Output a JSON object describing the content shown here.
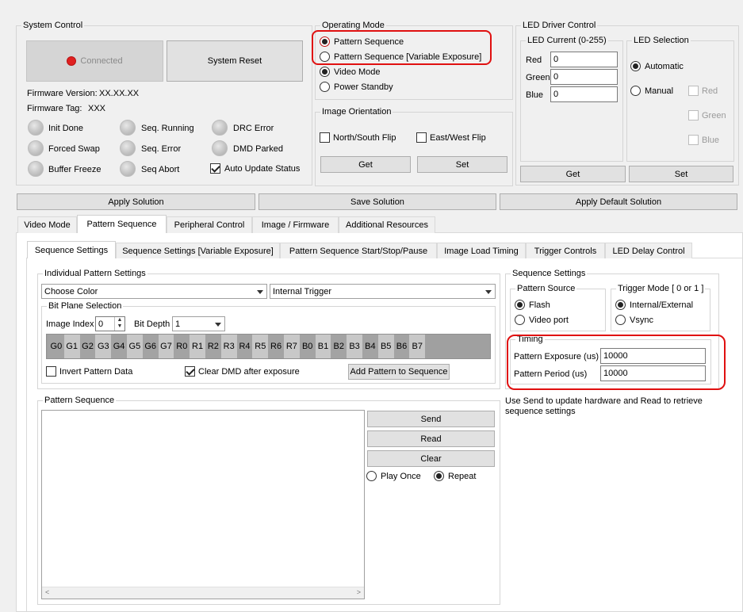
{
  "system_control": {
    "title": "System Control",
    "connected_label": "Connected",
    "reset_label": "System Reset",
    "firmware_version_label": "Firmware Version:",
    "firmware_version": "XX.XX.XX",
    "firmware_tag_label": "Firmware Tag:",
    "firmware_tag": "XXX",
    "status": {
      "init_done": "Init Done",
      "seq_running": "Seq. Running",
      "drc_error": "DRC Error",
      "forced_swap": "Forced Swap",
      "seq_error": "Seq. Error",
      "dmd_parked": "DMD Parked",
      "buffer_freeze": "Buffer Freeze",
      "seq_abort": "Seq Abort",
      "auto_update": "Auto Update Status"
    }
  },
  "operating_mode": {
    "title": "Operating Mode",
    "options": [
      "Pattern Sequence",
      "Pattern Sequence [Variable Exposure]",
      "Video Mode",
      "Power Standby"
    ]
  },
  "image_orientation": {
    "title": "Image Orientation",
    "ns_flip": "North/South Flip",
    "ew_flip": "East/West Flip",
    "get_label": "Get",
    "set_label": "Set"
  },
  "led_driver": {
    "title": "LED Driver Control",
    "current_title": "LED Current (0-255)",
    "red_label": "Red",
    "green_label": "Green",
    "blue_label": "Blue",
    "red_value": "0",
    "green_value": "0",
    "blue_value": "0",
    "selection_title": "LED Selection",
    "automatic": "Automatic",
    "manual": "Manual",
    "chk_red": "Red",
    "chk_green": "Green",
    "chk_blue": "Blue",
    "get_label": "Get",
    "set_label": "Set"
  },
  "solution": {
    "apply": "Apply Solution",
    "save": "Save Solution",
    "apply_default": "Apply Default Solution"
  },
  "main_tabs": [
    "Video Mode",
    "Pattern Sequence",
    "Peripheral Control",
    "Image / Firmware",
    "Additional Resources"
  ],
  "sub_tabs": [
    "Sequence Settings",
    "Sequence Settings [Variable Exposure]",
    "Pattern Sequence Start/Stop/Pause",
    "Image Load Timing",
    "Trigger Controls",
    "LED Delay Control"
  ],
  "individual": {
    "title": "Individual Pattern Settings",
    "color_select": "Choose Color",
    "trigger_select": "Internal Trigger",
    "bitplane_title": "Bit Plane Selection",
    "image_index_label": "Image Index",
    "image_index_value": "0",
    "bit_depth_label": "Bit Depth",
    "bit_depth_value": "1",
    "bits": [
      "G0",
      "G1",
      "G2",
      "G3",
      "G4",
      "G5",
      "G6",
      "G7",
      "R0",
      "R1",
      "R2",
      "R3",
      "R4",
      "R5",
      "R6",
      "R7",
      "B0",
      "B1",
      "B2",
      "B3",
      "B4",
      "B5",
      "B6",
      "B7"
    ],
    "invert_label": "Invert Pattern Data",
    "clear_dmd_label": "Clear DMD after exposure",
    "add_pattern_label": "Add Pattern to Sequence"
  },
  "sequence_settings": {
    "title": "Sequence Settings",
    "pattern_source_title": "Pattern Source",
    "flash": "Flash",
    "video_port": "Video port",
    "trigger_mode_title": "Trigger Mode [ 0 or 1 ]",
    "internal_external": "Internal/External",
    "vsync": "Vsync",
    "timing_title": "Timing",
    "exposure_label": "Pattern Exposure (us)",
    "exposure_value": "10000",
    "period_label": "Pattern Period (us)",
    "period_value": "10000",
    "hint_line1": "Use Send to update hardware and Read to retrieve",
    "hint_line2": "sequence settings"
  },
  "pattern_sequence": {
    "title": "Pattern Sequence",
    "send": "Send",
    "read": "Read",
    "clear": "Clear",
    "play_once": "Play Once",
    "repeat": "Repeat"
  },
  "colors": {
    "annotation": "#e01010",
    "connected_led": "#e02020"
  }
}
